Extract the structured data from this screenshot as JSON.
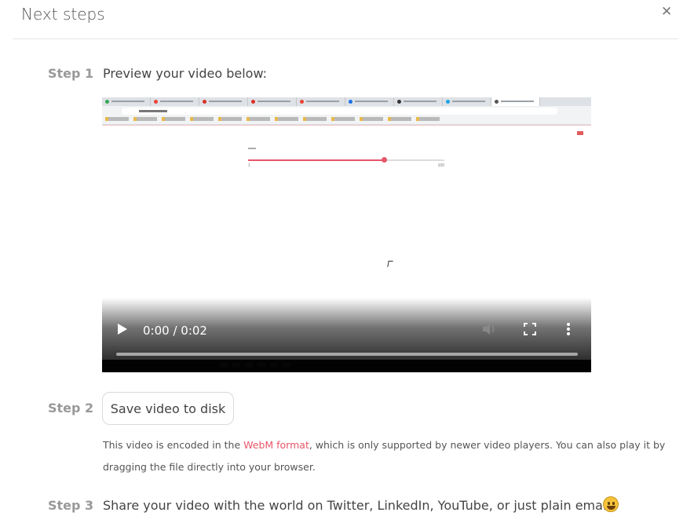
{
  "header": {
    "title": "Next steps",
    "close_icon": "close-icon"
  },
  "step1": {
    "label": "Step 1",
    "text": "Preview your video below:"
  },
  "video": {
    "time_display": "0:00 / 0:02",
    "slider_min": "1",
    "slider_max": "100",
    "slider_value_fraction": 0.69,
    "progress_fraction": 0,
    "icons": [
      "play-icon",
      "volume-icon",
      "fullscreen-icon",
      "more-options-icon"
    ]
  },
  "step2": {
    "label": "Step 2",
    "button_label": "Save video to disk",
    "note_before": "This video is encoded in the ",
    "note_link": "WebM format",
    "note_after": ", which is only supported by newer video players. You can also play it by dragging the file directly into your browser."
  },
  "step3": {
    "label": "Step 3",
    "text": "Share your video with the world on Twitter, LinkedIn, YouTube, or just plain email!",
    "emoji_icon": "grinning-face-icon"
  },
  "colors": {
    "accent": "#e8556a",
    "step_label": "#999999",
    "divider": "#e5e5e5"
  }
}
